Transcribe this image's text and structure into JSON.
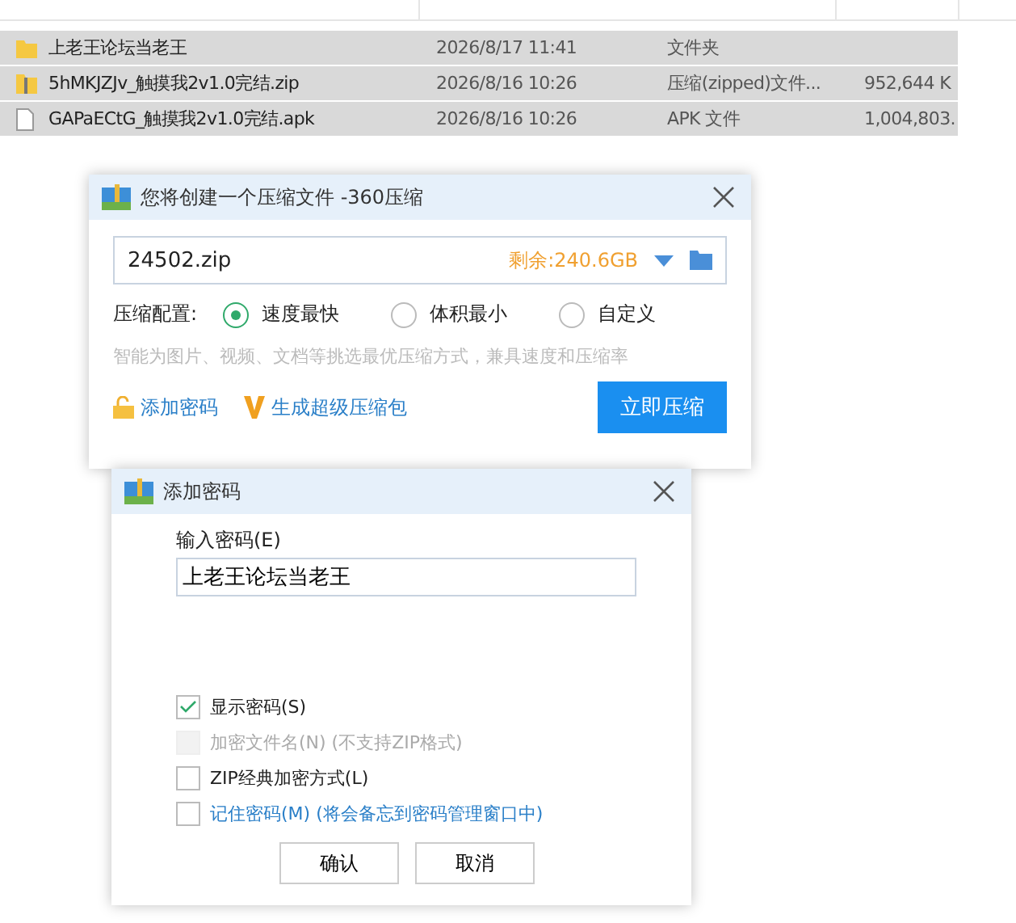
{
  "file_list": {
    "rows": [
      {
        "kind": "folder",
        "name": "上老王论坛当老王",
        "modified": "2026/8/17 11:41",
        "type": "文件夹",
        "size": "",
        "selected": true
      },
      {
        "kind": "zip",
        "name": "5hMKJZJv_触摸我2v1.0完结.zip",
        "modified": "2026/8/16 10:26",
        "type": "压缩(zipped)文件...",
        "size": "952,644 K",
        "selected": true
      },
      {
        "kind": "file",
        "name": "GAPaECtG_触摸我2v1.0完结.apk",
        "modified": "2026/8/16 10:26",
        "type": "APK 文件",
        "size": "1,004,803.",
        "selected": true
      }
    ]
  },
  "compress_dialog": {
    "title": "您将创建一个压缩文件 -360压缩",
    "filename": "24502.zip",
    "free_space": "剩余:240.6GB",
    "config_label": "压缩配置:",
    "options": [
      {
        "label": "速度最快",
        "selected": true
      },
      {
        "label": "体积最小",
        "selected": false
      },
      {
        "label": "自定义",
        "selected": false
      }
    ],
    "hint": "智能为图片、视频、文档等挑选最优压缩方式，兼具速度和压缩率",
    "add_password": "添加密码",
    "super_package": "生成超级压缩包",
    "compress_button": "立即压缩"
  },
  "password_dialog": {
    "title": "添加密码",
    "field_label": "输入密码(E)",
    "password": "上老王论坛当老王",
    "checkboxes": [
      {
        "kind": "plain",
        "label": "显示密码(S)",
        "checked": true,
        "disabled": false
      },
      {
        "kind": "plain",
        "label": "加密文件名(N) (不支持ZIP格式)",
        "checked": false,
        "disabled": true
      },
      {
        "kind": "plain",
        "label": "ZIP经典加密方式(L)",
        "checked": false,
        "disabled": false
      },
      {
        "kind": "link",
        "label": "记住密码(M) (将会备忘到密码管理窗口中)",
        "checked": false,
        "disabled": false
      }
    ],
    "buttons": [
      "确认",
      "取消"
    ]
  }
}
